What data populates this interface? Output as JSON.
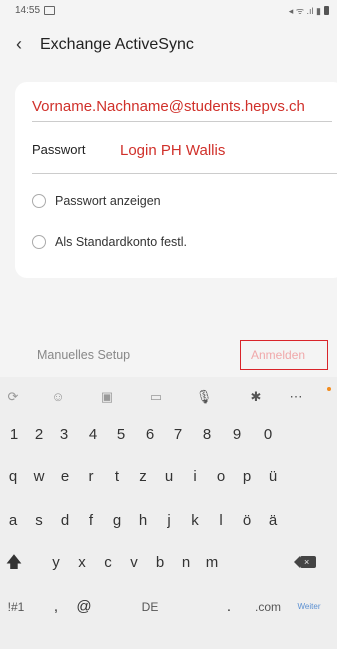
{
  "status": {
    "time": "14:55",
    "right_icons": "◂ ᯤ .ıl ▮"
  },
  "header": {
    "back_icon": "chevron-left",
    "title": "Exchange ActiveSync"
  },
  "form": {
    "email_value": "Vorname.Nachname@students.hepvs.ch",
    "password_label": "Passwort",
    "password_value": "Login PH Wallis",
    "show_password_label": "Passwort anzeigen",
    "default_account_label": "Als Standardkonto festl."
  },
  "actions": {
    "manual_setup": "Manuelles Setup",
    "login": "Anmelden"
  },
  "keyboard": {
    "toolbar": [
      "text-translate-icon",
      "emoji-icon",
      "sticker-icon",
      "gif-icon",
      "microphone-icon",
      "settings-icon",
      "more-icon"
    ],
    "numbers": [
      "1",
      "2",
      "3",
      "4",
      "5",
      "6",
      "7",
      "8",
      "9",
      "0"
    ],
    "row1": [
      "q",
      "w",
      "e",
      "r",
      "t",
      "z",
      "u",
      "i",
      "o",
      "p",
      "ü"
    ],
    "row2": [
      "a",
      "s",
      "d",
      "f",
      "g",
      "h",
      "j",
      "k",
      "l",
      "ö",
      "ä"
    ],
    "row3": [
      "y",
      "x",
      "c",
      "v",
      "b",
      "n",
      "m"
    ],
    "bottom": {
      "symbols": "!#1",
      "comma": ",",
      "at": "@",
      "space": "DE",
      "period": ".",
      "com": ".com",
      "enter": "Weiter"
    }
  },
  "colors": {
    "accent_red": "#d9242a",
    "email_text": "#d0302a"
  }
}
